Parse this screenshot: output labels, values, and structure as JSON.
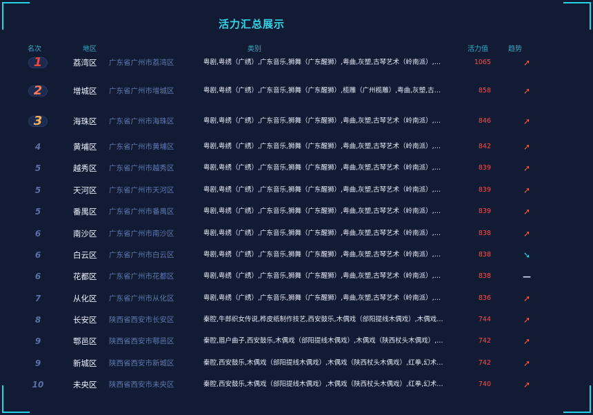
{
  "title": "活力汇总展示",
  "columns": {
    "rank": "名次",
    "area": "地区",
    "category": "类别",
    "value": "活力值",
    "trend": "趋势"
  },
  "colors": {
    "accent": "#35d4e8",
    "value": "#ff4d4d",
    "up": "#ff5a3d",
    "down": "#2ad6ea",
    "first": "#e5473f",
    "second": "#ff7a55",
    "third": "#f4b05a"
  },
  "rows": [
    {
      "rank": "1",
      "district": "荔湾区",
      "full": "广东省广州市荔湾区",
      "category": "粤剧,粤绣（广绣）,广东音乐,狮舞（广东醒狮）,粤曲,灰塑,古琴艺术（岭南派）,玉雕（...",
      "value": "1065",
      "trend": "up"
    },
    {
      "rank": "2",
      "district": "增城区",
      "full": "广东省广州市增城区",
      "category": "粤剧,粤绣（广绣）,广东音乐,狮舞（广东醒狮）,榄雕（广州榄雕）,粤曲,灰塑,古琴艺术...",
      "value": "858",
      "trend": "up"
    },
    {
      "rank": "3",
      "district": "海珠区",
      "full": "广东省广州市海珠区",
      "category": "粤剧,粤绣（广绣）,广东音乐,狮舞（广东醒狮）,粤曲,灰塑,古琴艺术（岭南派）,象牙雕...",
      "value": "846",
      "trend": "up"
    },
    {
      "rank": "4",
      "district": "黄埔区",
      "full": "广东省广州市黄埔区",
      "category": "粤剧,粤绣（广绣）,广东音乐,狮舞（广东醒狮）,粤曲,灰塑,古琴艺术（岭南派）,民间信...",
      "value": "842",
      "trend": "up"
    },
    {
      "rank": "5",
      "district": "越秀区",
      "full": "广东省广州市越秀区",
      "category": "粤剧,粤绣（广绣）,广东音乐,狮舞（广东醒狮）,粤曲,灰塑,古琴艺术（岭南派）,象牙雕...",
      "value": "839",
      "trend": "up"
    },
    {
      "rank": "5",
      "district": "天河区",
      "full": "广东省广州市天河区",
      "category": "粤剧,粤绣（广绣）,广东音乐,狮舞（广东醒狮）,粤曲,灰塑,古琴艺术（岭南派）,七夕节...",
      "value": "839",
      "trend": "up"
    },
    {
      "rank": "5",
      "district": "番禺区",
      "full": "广东省广州市番禺区",
      "category": "粤剧,粤绣（广绣）,广东音乐,狮舞（广东醒狮）,粤曲,灰塑,古琴艺术（岭南派）,象牙雕...",
      "value": "839",
      "trend": "up"
    },
    {
      "rank": "6",
      "district": "南沙区",
      "full": "广东省广州市南沙区",
      "category": "粤剧,粤绣（广绣）,广东音乐,狮舞（广东醒狮）,粤曲,灰塑,古琴艺术（岭南派）,象牙雕...",
      "value": "838",
      "trend": "up"
    },
    {
      "rank": "6",
      "district": "白云区",
      "full": "广东省广州市白云区",
      "category": "粤剧,粤绣（广绣）,广东音乐,狮舞（广东醒狮）,粤曲,灰塑,古琴艺术（岭南派）,象牙雕...",
      "value": "838",
      "trend": "down"
    },
    {
      "rank": "6",
      "district": "花都区",
      "full": "广东省广州市花都区",
      "category": "粤剧,粤绣（广绣）,广东音乐,狮舞（广东醒狮）,粤曲,灰塑,古琴艺术（岭南派）,象牙雕...",
      "value": "838",
      "trend": "flat"
    },
    {
      "rank": "7",
      "district": "从化区",
      "full": "广东省广州市从化区",
      "category": "粤剧,粤绣（广绣）,广东音乐,狮舞（广东醒狮）,粤曲,灰塑,古琴艺术（岭南派）,象牙雕...",
      "value": "836",
      "trend": "up"
    },
    {
      "rank": "8",
      "district": "长安区",
      "full": "陕西省西安市长安区",
      "category": "秦腔,牛郎织女传说,桦皮纸制作技艺,西安鼓乐,木偶戏（郃阳提线木偶戏）,木偶戏（陕...",
      "value": "744",
      "trend": "up"
    },
    {
      "rank": "9",
      "district": "鄠邑区",
      "full": "陕西省西安市鄠邑区",
      "category": "秦腔,眉户曲子,西安鼓乐,木偶戏（郃阳提线木偶戏）,木偶戏（陕西杖头木偶戏）,红拳,...",
      "value": "742",
      "trend": "up"
    },
    {
      "rank": "9",
      "district": "新城区",
      "full": "陕西省西安市新城区",
      "category": "秦腔,西安鼓乐,木偶戏（郃阳提线木偶戏）,木偶戏（陕西杖头木偶戏）,红拳,幻术（周...",
      "value": "742",
      "trend": "up"
    },
    {
      "rank": "10",
      "district": "未央区",
      "full": "陕西省西安市未央区",
      "category": "秦腔,西安鼓乐,木偶戏（郃阳提线木偶戏）,木偶戏（陕西杖头木偶戏）,红拳,幻术（周...",
      "value": "740",
      "trend": "up"
    }
  ]
}
